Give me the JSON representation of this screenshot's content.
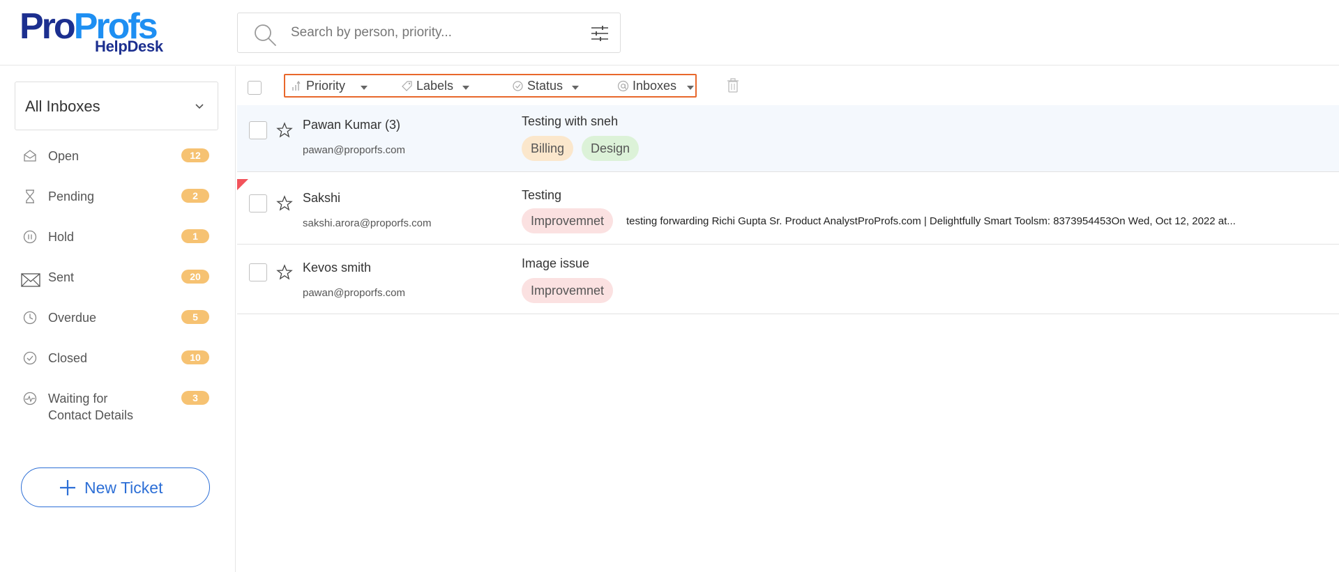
{
  "brand": {
    "logo_pro": "Pro",
    "logo_profs": "Profs",
    "logo_sub": "HelpDesk",
    "colors": {
      "navy": "#1c2f8f",
      "blue": "#1e8ff2",
      "accent": "#2d6fd6",
      "badge": "#f6c272",
      "filter_border": "#e8672b"
    }
  },
  "search": {
    "placeholder": "Search by person, priority...",
    "icon": "search-icon",
    "filter_icon": "sliders-icon"
  },
  "sidebar": {
    "inbox_selector": {
      "label": "All Inboxes",
      "icon": "chevron-down-icon"
    },
    "items": [
      {
        "label": "Open",
        "count": "12",
        "icon": "envelope-open-icon"
      },
      {
        "label": "Pending",
        "count": "2",
        "icon": "hourglass-icon"
      },
      {
        "label": "Hold",
        "count": "1",
        "icon": "pause-icon"
      },
      {
        "label": "Sent",
        "count": "20",
        "icon": "envelope-icon"
      },
      {
        "label": "Overdue",
        "count": "5",
        "icon": "clock-icon"
      },
      {
        "label": "Closed",
        "count": "10",
        "icon": "check-circle-icon"
      },
      {
        "label": "Waiting for",
        "label2": "Contact Details",
        "count": "3",
        "icon": "waiting-icon"
      }
    ],
    "new_ticket_label": "New Ticket"
  },
  "toolbar": {
    "filters": [
      {
        "label": "Priority",
        "icon": "priority-bars-icon"
      },
      {
        "label": "Labels",
        "icon": "tag-icon"
      },
      {
        "label": "Status",
        "icon": "check-status-icon"
      },
      {
        "label": "Inboxes",
        "icon": "at-icon"
      }
    ],
    "trash_icon": "trash-icon"
  },
  "tickets": [
    {
      "name": "Pawan Kumar (3)",
      "email": "pawan@proporfs.com",
      "subject": "Testing with sneh",
      "tags": [
        "Billing",
        "Design"
      ],
      "preview": "",
      "highlight": true,
      "flag": false
    },
    {
      "name": "Sakshi",
      "email": "sakshi.arora@proporfs.com",
      "subject": "Testing",
      "tags": [
        "Improvemnet"
      ],
      "preview": "testing forwarding Richi Gupta Sr. Product AnalystProProfs.com | Delightfully Smart Toolsm: 8373954453On Wed, Oct 12, 2022 at...",
      "highlight": false,
      "flag": true
    },
    {
      "name": "Kevos smith",
      "email": "pawan@proporfs.com",
      "subject": "Image issue",
      "tags": [
        "Improvemnet"
      ],
      "preview": "",
      "highlight": false,
      "flag": false
    }
  ]
}
